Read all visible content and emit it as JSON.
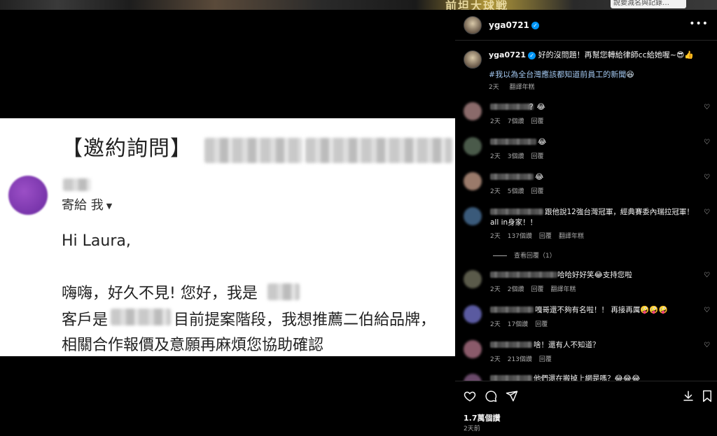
{
  "background": {
    "banner_text": "前坦大球戦",
    "search_text": "說要減名與記錄…"
  },
  "email": {
    "subject": "【邀約詢問】",
    "recipient_label": "寄給 我",
    "greeting": "Hi Laura,",
    "body_lines": [
      "嗨嗨，好久不見! 您好，我是",
      "客戶是",
      "目前提案階段，我想推薦二伯給品牌，",
      "相關合作報價及意願再麻煩您協助確認"
    ]
  },
  "post": {
    "username": "yga0721",
    "caption_text": "好的沒問題！再幫您轉給律師cc給她喔~😎👍",
    "hashtag": "#我以為全台灣應該都知道前員工的新聞",
    "hashtag_emoji": "😆",
    "caption_time": "2天",
    "caption_translate": "翻譯年糕",
    "likes": "1.7萬個讚",
    "date": "2天前"
  },
  "comments": [
    {
      "text": "？😂",
      "time": "2天",
      "likes": "7個讚",
      "reply": "回覆",
      "translate": ""
    },
    {
      "text": "😂",
      "time": "2天",
      "likes": "3個讚",
      "reply": "回覆",
      "translate": ""
    },
    {
      "text": "😂",
      "time": "2天",
      "likes": "5個讚",
      "reply": "回覆",
      "translate": ""
    },
    {
      "text": "跟他說12強台灣冠軍，經典賽委內瑞拉冠軍！",
      "text2": "all in身家！！",
      "time": "2天",
      "likes": "137個讚",
      "reply": "回覆",
      "translate": "翻譯年糕",
      "view_replies": "查看回覆（1）"
    },
    {
      "text": "哈哈好好笑😂支持您啦",
      "time": "2天",
      "likes": "2個讚",
      "reply": "回覆",
      "translate": "翻譯年糕"
    },
    {
      "text": "嘎哥還不夠有名啦！！ 再接再厲🤪🤪🤪",
      "time": "2天",
      "likes": "17個讚",
      "reply": "回覆",
      "translate": ""
    },
    {
      "text": "啥！還有人不知道？",
      "time": "2天",
      "likes": "213個讚",
      "reply": "回覆",
      "translate": ""
    },
    {
      "text": "他們還在搬掉上網是嗎？😂😂😂",
      "time": "",
      "likes": "",
      "reply": "",
      "translate": ""
    }
  ],
  "icons": [
    "heart-icon",
    "comment-icon",
    "share-icon",
    "save-icon",
    "more-icon",
    "verified-icon"
  ],
  "colors": {
    "verified": "#0095f6",
    "hashtag": "#a3c8f0",
    "panel_bg": "#000000",
    "muted": "#a8a8a8"
  }
}
